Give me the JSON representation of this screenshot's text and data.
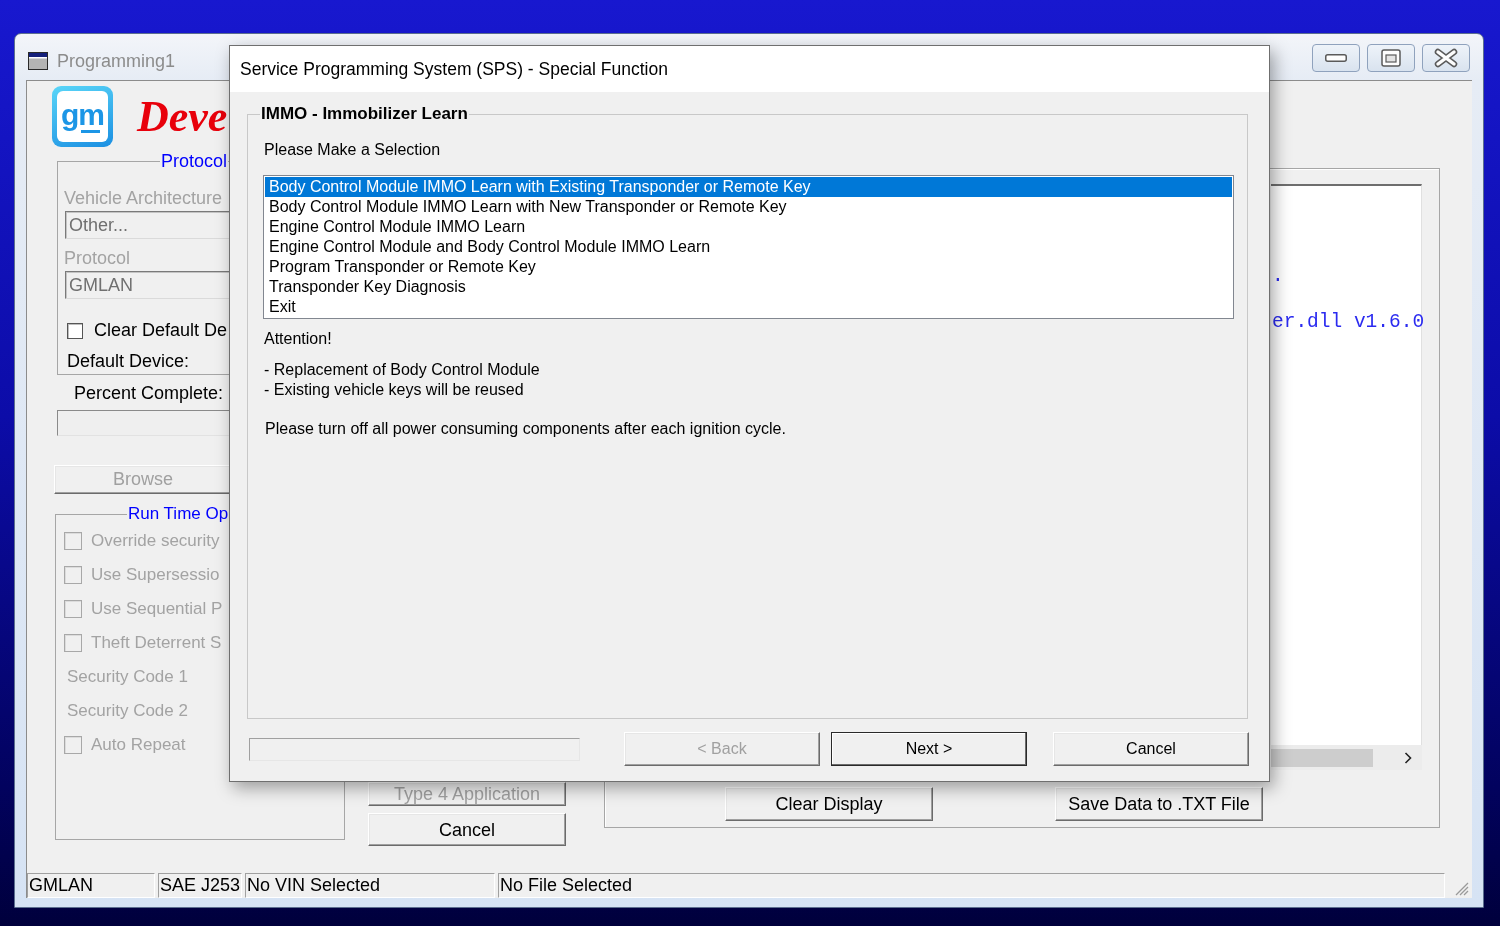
{
  "main_window": {
    "title": "Programming1",
    "logo_text": "gm",
    "app_title": "Deve",
    "protocol_group": {
      "legend": "Protocol",
      "fields": [
        {
          "label": "Vehicle Architecture",
          "value": "Other...",
          "disabled": true
        },
        {
          "label": "Protocol",
          "value": "GMLAN",
          "disabled": true
        }
      ],
      "clear_default_device": {
        "label": "Clear Default De",
        "checked": false,
        "disabled": false
      },
      "default_device_label": "Default Device:"
    },
    "percent_complete_label": "Percent Complete:",
    "browse_button": {
      "label": "Browse",
      "disabled": true
    },
    "run_time_options": {
      "legend": "Run Time Op",
      "items": [
        {
          "kind": "checkbox",
          "label": "Override security",
          "checked": false,
          "disabled": true
        },
        {
          "kind": "checkbox",
          "label": "Use Supersessio",
          "checked": false,
          "disabled": true
        },
        {
          "kind": "checkbox",
          "label": "Use Sequential P",
          "checked": false,
          "disabled": true
        },
        {
          "kind": "checkbox",
          "label": "Theft Deterrent S",
          "checked": false,
          "disabled": true
        },
        {
          "kind": "field",
          "label": "Security Code 1",
          "disabled": true
        },
        {
          "kind": "field",
          "label": "Security Code 2",
          "disabled": true
        },
        {
          "kind": "checkbox",
          "label": "Auto Repeat",
          "checked": false,
          "disabled": true
        }
      ]
    },
    "action_buttons": [
      {
        "label": "Type 4 Application",
        "disabled": true
      },
      {
        "label": "Cancel",
        "disabled": false
      }
    ],
    "output": {
      "lines": [
        ".",
        "er.dll v1.6.0"
      ]
    },
    "output_buttons": [
      "Clear Display",
      "Save Data to .TXT File"
    ],
    "status_bar": [
      "GMLAN",
      "SAE J253",
      "No VIN Selected",
      "No File Selected"
    ]
  },
  "dialog": {
    "title": "Service Programming System (SPS) - Special Function",
    "group_legend": "IMMO - Immobilizer Learn",
    "prompt": "Please Make a Selection",
    "options": [
      {
        "label": "Body Control Module IMMO Learn with Existing Transponder or Remote Key",
        "selected": true
      },
      {
        "label": "Body Control Module IMMO Learn with New Transponder or Remote Key",
        "selected": false
      },
      {
        "label": "Engine Control Module IMMO Learn",
        "selected": false
      },
      {
        "label": "Engine Control Module and Body Control Module IMMO Learn",
        "selected": false
      },
      {
        "label": "Program Transponder or Remote Key",
        "selected": false
      },
      {
        "label": "Transponder Key Diagnosis",
        "selected": false
      },
      {
        "label": "Exit",
        "selected": false
      }
    ],
    "attention": "Attention!",
    "notes": [
      "- Replacement of Body Control Module",
      "- Existing vehicle keys will be reused"
    ],
    "instruction": "Please turn off all power consuming components after each ignition cycle.",
    "buttons": [
      {
        "label": "< Back",
        "disabled": true,
        "default": false
      },
      {
        "label": "Next >",
        "disabled": false,
        "default": true
      },
      {
        "label": "Cancel",
        "disabled": false,
        "default": false
      }
    ]
  }
}
